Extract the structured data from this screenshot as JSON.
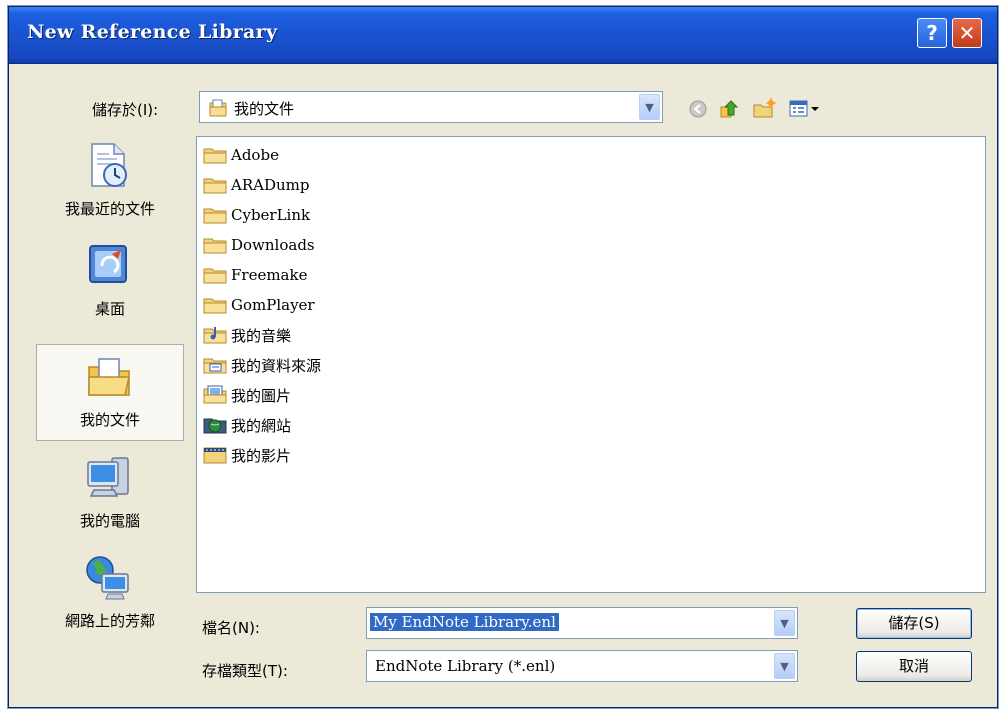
{
  "window": {
    "title": "New Reference Library",
    "help_label": "?",
    "close_label": "✕"
  },
  "save_in": {
    "label": "儲存於(I):",
    "value": "我的文件"
  },
  "places": [
    {
      "label": "我最近的文件",
      "icon": "recent-documents-icon"
    },
    {
      "label": "桌面",
      "icon": "desktop-icon"
    },
    {
      "label": "我的文件",
      "icon": "my-documents-icon"
    },
    {
      "label": "我的電腦",
      "icon": "my-computer-icon"
    },
    {
      "label": "網路上的芳鄰",
      "icon": "network-places-icon"
    }
  ],
  "files": [
    {
      "name": "Adobe",
      "icon": "folder-icon"
    },
    {
      "name": "ARADump",
      "icon": "folder-icon"
    },
    {
      "name": "CyberLink",
      "icon": "folder-icon"
    },
    {
      "name": "Downloads",
      "icon": "folder-icon"
    },
    {
      "name": "Freemake",
      "icon": "folder-icon"
    },
    {
      "name": "GomPlayer",
      "icon": "folder-icon"
    },
    {
      "name": "我的音樂",
      "icon": "music-folder-icon"
    },
    {
      "name": "我的資料來源",
      "icon": "data-sources-folder-icon"
    },
    {
      "name": "我的圖片",
      "icon": "pictures-folder-icon"
    },
    {
      "name": "我的網站",
      "icon": "websites-folder-icon"
    },
    {
      "name": "我的影片",
      "icon": "videos-folder-icon"
    }
  ],
  "filename": {
    "label": "檔名(N):",
    "value": "My EndNote Library.enl"
  },
  "filetype": {
    "label": "存檔類型(T):",
    "value": "EndNote Library (*.enl)"
  },
  "buttons": {
    "save": "儲存(S)",
    "cancel": "取消"
  },
  "colors": {
    "titlebar": "#1a53d0",
    "selection": "#316ac5",
    "dialog_bg": "#ece9d8"
  }
}
